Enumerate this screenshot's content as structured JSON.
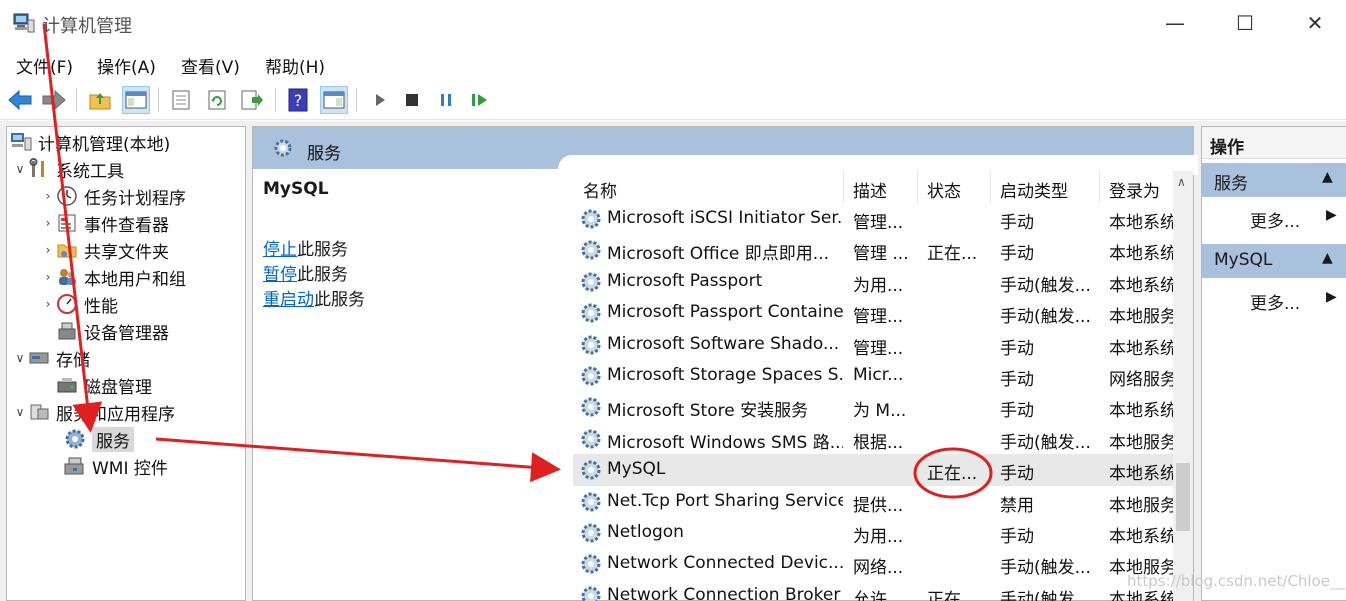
{
  "window": {
    "title": "计算机管理",
    "minimize": "—",
    "maximize": "☐",
    "close": "✕"
  },
  "menu": [
    {
      "label": "文件(F)"
    },
    {
      "label": "操作(A)"
    },
    {
      "label": "查看(V)"
    },
    {
      "label": "帮助(H)"
    }
  ],
  "toolbar": {
    "icons": [
      "back-arrow-icon",
      "forward-arrow-icon",
      "up-folder-icon",
      "show-hide-tree-icon",
      "properties-icon",
      "refresh-icon",
      "export-list-icon",
      "help-icon",
      "show-hide-action-pane-icon",
      "start-service-icon",
      "stop-service-icon",
      "pause-service-icon",
      "resume-service-icon"
    ]
  },
  "tree": {
    "root": "计算机管理(本地)",
    "system_tools": "系统工具",
    "items": [
      {
        "label": "任务计划程序"
      },
      {
        "label": "事件查看器"
      },
      {
        "label": "共享文件夹"
      },
      {
        "label": "本地用户和组"
      },
      {
        "label": "性能"
      },
      {
        "label": "设备管理器"
      }
    ],
    "storage": "存储",
    "disk_mgmt": "磁盘管理",
    "services_apps": "服务和应用程序",
    "services": "服务",
    "wmi": "WMI 控件"
  },
  "center": {
    "header_title": "服务",
    "selected_service": "MySQL",
    "actions": [
      {
        "link": "停止",
        "rest": "此服务"
      },
      {
        "link": "暂停",
        "rest": "此服务"
      },
      {
        "link": "重启动",
        "rest": "此服务"
      }
    ]
  },
  "list": {
    "columns": {
      "name": "名称",
      "desc": "描述",
      "state": "状态",
      "start": "启动类型",
      "logon": "登录为"
    },
    "sort_caret": "^",
    "rows": [
      {
        "name": "Microsoft iSCSI Initiator Ser...",
        "desc": "管理...",
        "state": "",
        "start": "手动",
        "logon": "本地系统"
      },
      {
        "name": "Microsoft Office 即点即用...",
        "desc": "管理 ...",
        "state": "正在...",
        "start": "手动",
        "logon": "本地系统"
      },
      {
        "name": "Microsoft Passport",
        "desc": "为用...",
        "state": "",
        "start": "手动(触发...",
        "logon": "本地系统"
      },
      {
        "name": "Microsoft Passport Container",
        "desc": "管理...",
        "state": "",
        "start": "手动(触发...",
        "logon": "本地服务"
      },
      {
        "name": "Microsoft Software Shado...",
        "desc": "管理...",
        "state": "",
        "start": "手动",
        "logon": "本地系统"
      },
      {
        "name": "Microsoft Storage Spaces S...",
        "desc": "Micr...",
        "state": "",
        "start": "手动",
        "logon": "网络服务"
      },
      {
        "name": "Microsoft Store 安装服务",
        "desc": "为 M...",
        "state": "",
        "start": "手动",
        "logon": "本地系统"
      },
      {
        "name": "Microsoft Windows SMS 路...",
        "desc": "根据...",
        "state": "",
        "start": "手动(触发...",
        "logon": "本地服务"
      },
      {
        "name": "MySQL",
        "desc": "",
        "state": "正在...",
        "start": "手动",
        "logon": "本地系统"
      },
      {
        "name": "Net.Tcp Port Sharing Service",
        "desc": "提供...",
        "state": "",
        "start": "禁用",
        "logon": "本地服务"
      },
      {
        "name": "Netlogon",
        "desc": "为用...",
        "state": "",
        "start": "手动",
        "logon": "本地系统"
      },
      {
        "name": "Network Connected Devic...",
        "desc": "网络...",
        "state": "",
        "start": "手动(触发...",
        "logon": "本地服务"
      },
      {
        "name": "Network Connection Broker",
        "desc": "允许...",
        "state": "正在...",
        "start": "手动(触发...",
        "logon": "本地系统"
      }
    ]
  },
  "actions_pane": {
    "title": "操作",
    "group1": "服务",
    "group2": "MySQL",
    "more": "更多..."
  },
  "watermark": "https://blog.csdn.net/Chloe__",
  "colors": {
    "header_blue": "#a9c1dc",
    "annotation_red": "#e02020",
    "link_blue": "#0066cc"
  }
}
